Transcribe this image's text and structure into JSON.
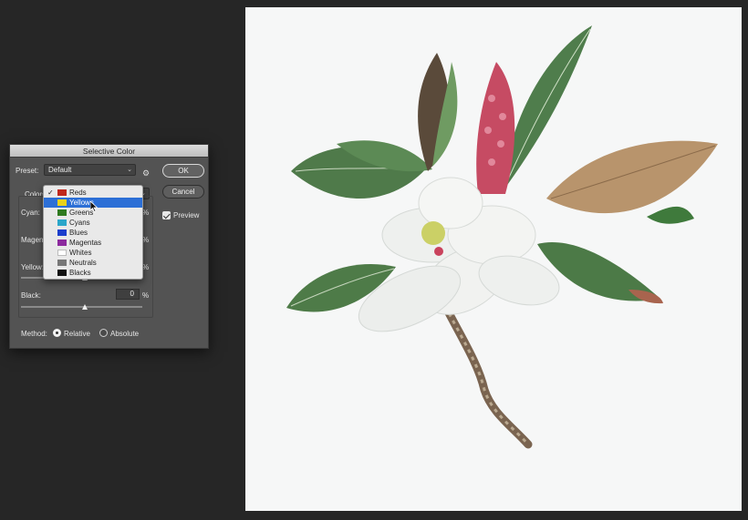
{
  "dialog": {
    "title": "Selective Color",
    "preset_label": "Preset:",
    "preset_value": "Default",
    "colors_label": "Colors:",
    "ok_label": "OK",
    "cancel_label": "Cancel",
    "preview_label": "Preview",
    "preview_checked": true,
    "sliders": {
      "cyan_label": "Cyan:",
      "magenta_label": "Magenta:",
      "yellow_label": "Yellow:",
      "black_label": "Black:",
      "black_value": "0",
      "percent": "%"
    },
    "method_label": "Method:",
    "method_relative": "Relative",
    "method_absolute": "Absolute",
    "method_selected": "Relative"
  },
  "colors_menu": {
    "checked": "Reds",
    "highlighted": "Yellows",
    "items": [
      {
        "label": "Reds",
        "swatch": "#c0281c"
      },
      {
        "label": "Yellows",
        "swatch": "#e8d21a"
      },
      {
        "label": "Greens",
        "swatch": "#2f7a1f"
      },
      {
        "label": "Cyans",
        "swatch": "#2aa6c9"
      },
      {
        "label": "Blues",
        "swatch": "#1b3ecc"
      },
      {
        "label": "Magentas",
        "swatch": "#8c2a9e"
      },
      {
        "label": "Whites",
        "swatch": "#ffffff"
      },
      {
        "label": "Neutrals",
        "swatch": "#777777"
      },
      {
        "label": "Blacks",
        "swatch": "#111111"
      }
    ]
  },
  "colors": {
    "app_background": "#262626",
    "dialog_background": "#535353",
    "highlight": "#2c6fd6",
    "canvas": "#f6f7f7"
  }
}
